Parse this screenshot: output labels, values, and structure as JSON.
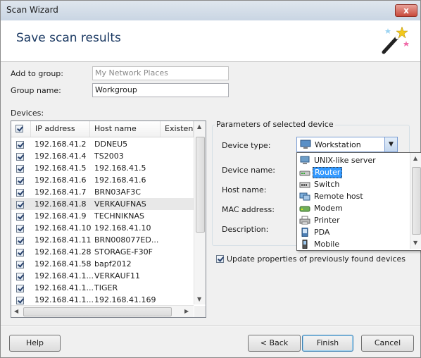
{
  "window": {
    "title": "Scan Wizard",
    "close_glyph": "x"
  },
  "header": {
    "title": "Save scan results",
    "icon": "magic-wand-icon"
  },
  "form": {
    "add_to_group_label": "Add to group:",
    "add_to_group_value": "My Network Places",
    "group_name_label": "Group name:",
    "group_name_value": "Workgroup"
  },
  "devices": {
    "label": "Devices:",
    "columns": [
      "IP address",
      "Host name",
      "Existenc"
    ],
    "rows": [
      {
        "ip": "192.168.41.2",
        "host": "DDNEU5",
        "checked": true
      },
      {
        "ip": "192.168.41.4",
        "host": "TS2003",
        "checked": true
      },
      {
        "ip": "192.168.41.5",
        "host": "192.168.41.5",
        "checked": true
      },
      {
        "ip": "192.168.41.6",
        "host": "192.168.41.6",
        "checked": true
      },
      {
        "ip": "192.168.41.7",
        "host": "BRN03AF3C",
        "checked": true
      },
      {
        "ip": "192.168.41.8",
        "host": "VERKAUFNAS",
        "checked": true,
        "selected": true
      },
      {
        "ip": "192.168.41.9",
        "host": "TECHNIKNAS",
        "checked": true
      },
      {
        "ip": "192.168.41.10",
        "host": "192.168.41.10",
        "checked": true
      },
      {
        "ip": "192.168.41.11",
        "host": "BRN008077ED...",
        "checked": true
      },
      {
        "ip": "192.168.41.28",
        "host": "STORAGE-F30F",
        "checked": true
      },
      {
        "ip": "192.168.41.58",
        "host": "bapf2012",
        "checked": true
      },
      {
        "ip": "192.168.41.1...",
        "host": "VERKAUF11",
        "checked": true
      },
      {
        "ip": "192.168.41.1...",
        "host": "TIGER",
        "checked": true
      },
      {
        "ip": "192.168.41.1...",
        "host": "192.168.41.169",
        "checked": true
      }
    ]
  },
  "params": {
    "title": "Parameters of selected device",
    "device_type_label": "Device type:",
    "device_type_value": "Workstation",
    "device_name_label": "Device name:",
    "host_name_label": "Host name:",
    "mac_label": "MAC address:",
    "description_label": "Description:",
    "dropdown_options": [
      {
        "label": "UNIX-like server",
        "icon": "server-icon"
      },
      {
        "label": "Router",
        "icon": "router-icon",
        "highlighted": true
      },
      {
        "label": "Switch",
        "icon": "switch-icon"
      },
      {
        "label": "Remote host",
        "icon": "remote-host-icon"
      },
      {
        "label": "Modem",
        "icon": "modem-icon"
      },
      {
        "label": "Printer",
        "icon": "printer-icon"
      },
      {
        "label": "PDA",
        "icon": "pda-icon"
      },
      {
        "label": "Mobile",
        "icon": "mobile-icon"
      }
    ]
  },
  "update_label": "Update properties of previously found devices",
  "buttons": {
    "help": "Help",
    "back": "< Back",
    "finish": "Finish",
    "cancel": "Cancel"
  },
  "colors": {
    "accent": "#3399ff",
    "header_title": "#1c3a63"
  }
}
